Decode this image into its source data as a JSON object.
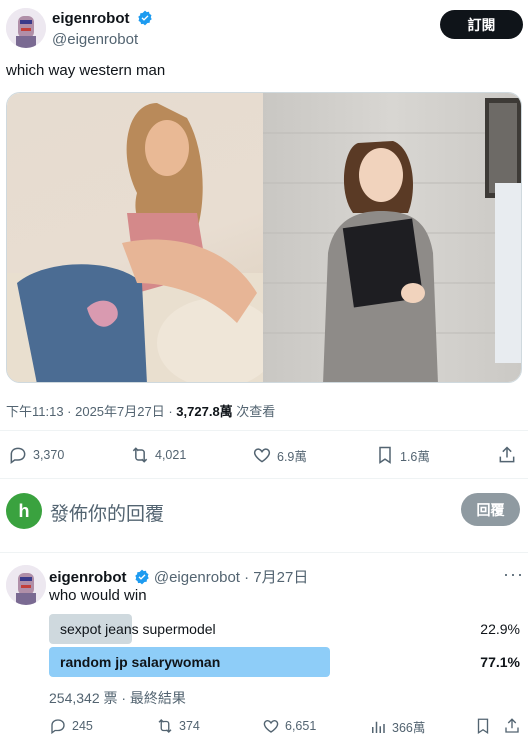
{
  "main_tweet": {
    "author_name": "eigenrobot",
    "author_handle": "@eigenrobot",
    "subscribe_label": "訂閱",
    "text": "which way western man",
    "timestamp": "下午11:13 · 2025年7月27日 · ",
    "views_count": "3,727.8萬",
    "views_label": " 次查看",
    "stats": {
      "replies": "3,370",
      "reposts": "4,021",
      "likes": "6.9萬",
      "bookmarks": "1.6萬"
    }
  },
  "reply_composer": {
    "avatar_letter": "h",
    "placeholder": "發佈你的回覆",
    "button_label": "回覆"
  },
  "quoted_tweet": {
    "author_name": "eigenrobot",
    "author_handle": "@eigenrobot",
    "date": "· 7月27日",
    "text": "who would win",
    "poll": {
      "options": [
        {
          "label": "sexpot jeans supermodel",
          "percent": "22.9%",
          "fraction": 0.229,
          "winner": false
        },
        {
          "label": "random jp salarywoman",
          "percent": "77.1%",
          "fraction": 0.771,
          "winner": true
        }
      ],
      "footer": "254,342 票 · 最終結果"
    },
    "stats": {
      "replies": "245",
      "reposts": "374",
      "likes": "6,651",
      "views": "366萬"
    }
  },
  "colors": {
    "accent": "#1d9bf0",
    "poll_winner": "#8ecdf8",
    "poll_loser": "#cfd9de",
    "muted": "#536471"
  }
}
